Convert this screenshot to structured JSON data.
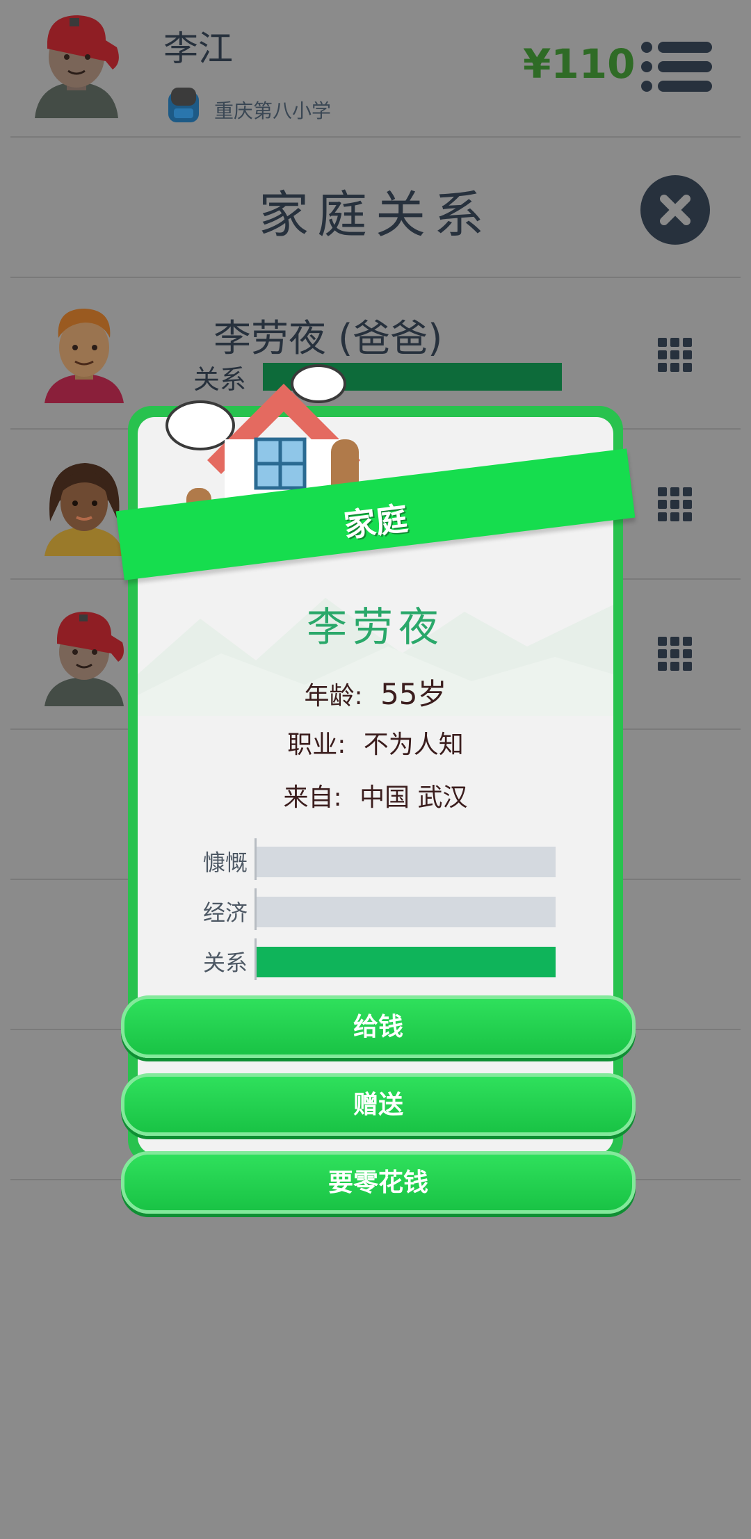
{
  "header": {
    "player_name": "李江",
    "school": "重庆第八小学",
    "money": "¥110"
  },
  "page": {
    "title": "家庭关系",
    "rows": [
      {
        "name": "李劳夜 (爸爸)",
        "relation_label": "关系",
        "relation_value": 1.0
      }
    ]
  },
  "modal": {
    "banner": "家庭",
    "name": "李劳夜",
    "age_label": "年龄:",
    "age_value": "55岁",
    "job_label": "职业:",
    "job_value": "不为人知",
    "from_label": "来自:",
    "from_value": "中国 武汉",
    "stats": [
      {
        "label": "慷慨",
        "value": 0
      },
      {
        "label": "经济",
        "value": 0
      },
      {
        "label": "关系",
        "value": 1.0
      }
    ],
    "buttons": [
      "给钱",
      "赠送",
      "要零花钱"
    ]
  },
  "colors": {
    "background_dim": "#8b8b8b",
    "money": "#2f6b26",
    "card_border": "#28c24e",
    "ribbon": "#16dd4e",
    "name_green": "#2aa86a",
    "stat_fill": "#0fb45a"
  }
}
